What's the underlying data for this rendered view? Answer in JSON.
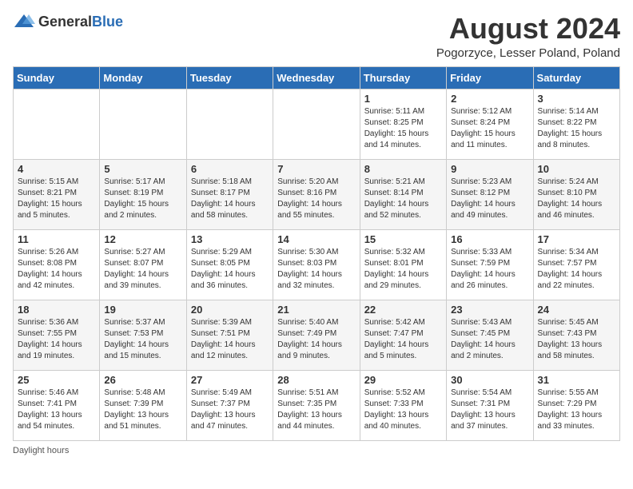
{
  "header": {
    "logo_general": "General",
    "logo_blue": "Blue",
    "month_title": "August 2024",
    "location": "Pogorzyce, Lesser Poland, Poland"
  },
  "days_of_week": [
    "Sunday",
    "Monday",
    "Tuesday",
    "Wednesday",
    "Thursday",
    "Friday",
    "Saturday"
  ],
  "weeks": [
    [
      {
        "day": "",
        "info": ""
      },
      {
        "day": "",
        "info": ""
      },
      {
        "day": "",
        "info": ""
      },
      {
        "day": "",
        "info": ""
      },
      {
        "day": "1",
        "info": "Sunrise: 5:11 AM\nSunset: 8:25 PM\nDaylight: 15 hours\nand 14 minutes."
      },
      {
        "day": "2",
        "info": "Sunrise: 5:12 AM\nSunset: 8:24 PM\nDaylight: 15 hours\nand 11 minutes."
      },
      {
        "day": "3",
        "info": "Sunrise: 5:14 AM\nSunset: 8:22 PM\nDaylight: 15 hours\nand 8 minutes."
      }
    ],
    [
      {
        "day": "4",
        "info": "Sunrise: 5:15 AM\nSunset: 8:21 PM\nDaylight: 15 hours\nand 5 minutes."
      },
      {
        "day": "5",
        "info": "Sunrise: 5:17 AM\nSunset: 8:19 PM\nDaylight: 15 hours\nand 2 minutes."
      },
      {
        "day": "6",
        "info": "Sunrise: 5:18 AM\nSunset: 8:17 PM\nDaylight: 14 hours\nand 58 minutes."
      },
      {
        "day": "7",
        "info": "Sunrise: 5:20 AM\nSunset: 8:16 PM\nDaylight: 14 hours\nand 55 minutes."
      },
      {
        "day": "8",
        "info": "Sunrise: 5:21 AM\nSunset: 8:14 PM\nDaylight: 14 hours\nand 52 minutes."
      },
      {
        "day": "9",
        "info": "Sunrise: 5:23 AM\nSunset: 8:12 PM\nDaylight: 14 hours\nand 49 minutes."
      },
      {
        "day": "10",
        "info": "Sunrise: 5:24 AM\nSunset: 8:10 PM\nDaylight: 14 hours\nand 46 minutes."
      }
    ],
    [
      {
        "day": "11",
        "info": "Sunrise: 5:26 AM\nSunset: 8:08 PM\nDaylight: 14 hours\nand 42 minutes."
      },
      {
        "day": "12",
        "info": "Sunrise: 5:27 AM\nSunset: 8:07 PM\nDaylight: 14 hours\nand 39 minutes."
      },
      {
        "day": "13",
        "info": "Sunrise: 5:29 AM\nSunset: 8:05 PM\nDaylight: 14 hours\nand 36 minutes."
      },
      {
        "day": "14",
        "info": "Sunrise: 5:30 AM\nSunset: 8:03 PM\nDaylight: 14 hours\nand 32 minutes."
      },
      {
        "day": "15",
        "info": "Sunrise: 5:32 AM\nSunset: 8:01 PM\nDaylight: 14 hours\nand 29 minutes."
      },
      {
        "day": "16",
        "info": "Sunrise: 5:33 AM\nSunset: 7:59 PM\nDaylight: 14 hours\nand 26 minutes."
      },
      {
        "day": "17",
        "info": "Sunrise: 5:34 AM\nSunset: 7:57 PM\nDaylight: 14 hours\nand 22 minutes."
      }
    ],
    [
      {
        "day": "18",
        "info": "Sunrise: 5:36 AM\nSunset: 7:55 PM\nDaylight: 14 hours\nand 19 minutes."
      },
      {
        "day": "19",
        "info": "Sunrise: 5:37 AM\nSunset: 7:53 PM\nDaylight: 14 hours\nand 15 minutes."
      },
      {
        "day": "20",
        "info": "Sunrise: 5:39 AM\nSunset: 7:51 PM\nDaylight: 14 hours\nand 12 minutes."
      },
      {
        "day": "21",
        "info": "Sunrise: 5:40 AM\nSunset: 7:49 PM\nDaylight: 14 hours\nand 9 minutes."
      },
      {
        "day": "22",
        "info": "Sunrise: 5:42 AM\nSunset: 7:47 PM\nDaylight: 14 hours\nand 5 minutes."
      },
      {
        "day": "23",
        "info": "Sunrise: 5:43 AM\nSunset: 7:45 PM\nDaylight: 14 hours\nand 2 minutes."
      },
      {
        "day": "24",
        "info": "Sunrise: 5:45 AM\nSunset: 7:43 PM\nDaylight: 13 hours\nand 58 minutes."
      }
    ],
    [
      {
        "day": "25",
        "info": "Sunrise: 5:46 AM\nSunset: 7:41 PM\nDaylight: 13 hours\nand 54 minutes."
      },
      {
        "day": "26",
        "info": "Sunrise: 5:48 AM\nSunset: 7:39 PM\nDaylight: 13 hours\nand 51 minutes."
      },
      {
        "day": "27",
        "info": "Sunrise: 5:49 AM\nSunset: 7:37 PM\nDaylight: 13 hours\nand 47 minutes."
      },
      {
        "day": "28",
        "info": "Sunrise: 5:51 AM\nSunset: 7:35 PM\nDaylight: 13 hours\nand 44 minutes."
      },
      {
        "day": "29",
        "info": "Sunrise: 5:52 AM\nSunset: 7:33 PM\nDaylight: 13 hours\nand 40 minutes."
      },
      {
        "day": "30",
        "info": "Sunrise: 5:54 AM\nSunset: 7:31 PM\nDaylight: 13 hours\nand 37 minutes."
      },
      {
        "day": "31",
        "info": "Sunrise: 5:55 AM\nSunset: 7:29 PM\nDaylight: 13 hours\nand 33 minutes."
      }
    ]
  ],
  "footer": {
    "note": "Daylight hours"
  }
}
